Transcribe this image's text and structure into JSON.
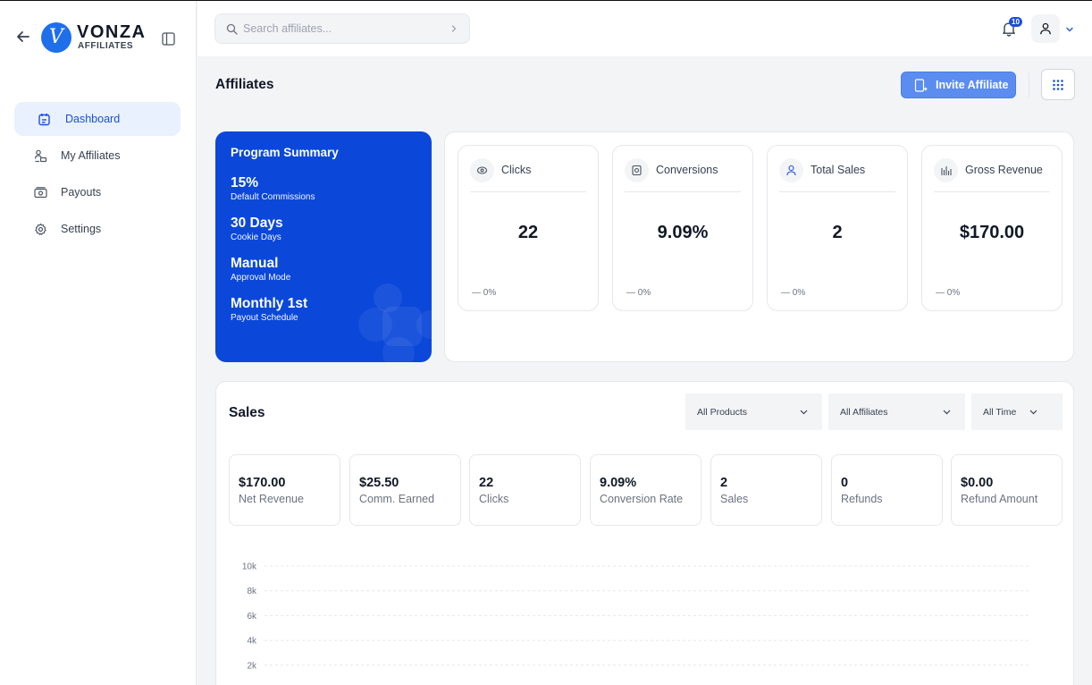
{
  "brand": {
    "name": "VONZA",
    "sub": "AFFILIATES",
    "logo_letter": "V"
  },
  "sidebar": {
    "items": [
      {
        "label": "Dashboard",
        "icon": "dashboard-icon",
        "active": true
      },
      {
        "label": "My Affiliates",
        "icon": "affiliates-icon",
        "active": false
      },
      {
        "label": "Payouts",
        "icon": "payouts-icon",
        "active": false
      },
      {
        "label": "Settings",
        "icon": "gear-icon",
        "active": false
      }
    ]
  },
  "topbar": {
    "search_placeholder": "Search affiliates...",
    "notification_count": "10"
  },
  "page": {
    "title": "Affiliates",
    "invite_label": "Invite Affiliate"
  },
  "program_summary": {
    "title": "Program Summary",
    "items": [
      {
        "value": "15%",
        "label": "Default Commissions"
      },
      {
        "value": "30 Days",
        "label": "Cookie Days"
      },
      {
        "value": "Manual",
        "label": "Approval Mode"
      },
      {
        "value": "Monthly 1st",
        "label": "Payout Schedule"
      }
    ]
  },
  "metrics": [
    {
      "label": "Clicks",
      "value": "22",
      "delta": "0%",
      "icon": "clicks-icon"
    },
    {
      "label": "Conversions",
      "value": "9.09%",
      "delta": "0%",
      "icon": "conversions-icon"
    },
    {
      "label": "Total Sales",
      "value": "2",
      "delta": "0%",
      "icon": "user-icon"
    },
    {
      "label": "Gross Revenue",
      "value": "$170.00",
      "delta": "0%",
      "icon": "bar-chart-icon"
    }
  ],
  "sales": {
    "title": "Sales",
    "filters": [
      {
        "label": "All Products"
      },
      {
        "label": "All Affiliates"
      },
      {
        "label": "All Time"
      }
    ],
    "stats": [
      {
        "value": "$170.00",
        "label": "Net Revenue"
      },
      {
        "value": "$25.50",
        "label": "Comm. Earned"
      },
      {
        "value": "22",
        "label": "Clicks"
      },
      {
        "value": "9.09%",
        "label": "Conversion Rate"
      },
      {
        "value": "2",
        "label": "Sales"
      },
      {
        "value": "0",
        "label": "Refunds"
      },
      {
        "value": "$0.00",
        "label": "Refund Amount"
      }
    ]
  },
  "chart_data": {
    "type": "line",
    "ylim": [
      0,
      10000
    ],
    "y_ticks": [
      "10k",
      "8k",
      "6k",
      "4k",
      "2k"
    ],
    "grid": true,
    "colors": {
      "accent": "#0b48d9"
    }
  }
}
